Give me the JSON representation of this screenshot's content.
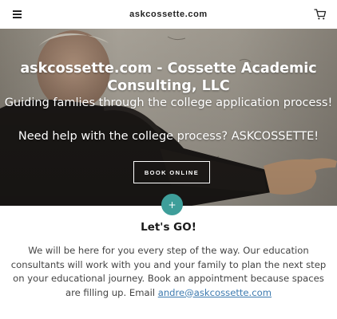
{
  "header": {
    "site_title": "askcossette.com",
    "menu_icon": "hamburger-menu-icon",
    "cart_icon": "shopping-cart-icon"
  },
  "hero": {
    "title": "askcossette.com - Cossette Academic Consulting, LLC",
    "tagline_1": "Guiding famlies through the college application process!",
    "tagline_2": "Need help with the college process?  ASKCOSSETTE!",
    "book_button": "BOOK ONLINE",
    "image": "man-pointing-at-whiteboard-photo"
  },
  "fab": {
    "label": "+",
    "color": "#3e9e9a"
  },
  "section": {
    "heading": "Let's GO!",
    "body": "We will be here for you every step of the way. Our education consultants will work with you and your family to plan the next step on your educational journey. Book an appointment because spaces are filling up. Email ",
    "email": "andre@askcossette.com"
  },
  "colors": {
    "accent": "#3e9e9a",
    "link": "#3e7bb0",
    "text": "#444444"
  }
}
